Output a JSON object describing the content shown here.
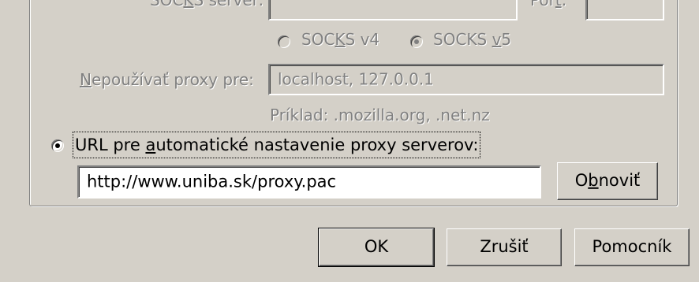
{
  "proxy": {
    "socks_server_label": "SO_C_KS server:",
    "port_label": "Port:",
    "socks_v4": {
      "prefix": "SOC",
      "u": "K",
      "suffix": "S v4"
    },
    "socks_v5": {
      "prefix": "SOCKS ",
      "u": "v",
      "suffix": "5"
    },
    "no_proxy": {
      "u": "N",
      "rest": "epoužívať proxy pre:",
      "value": "localhost, 127.0.0.1"
    },
    "example": "Príklad: .mozilla.org, .net.nz",
    "auto_url": {
      "prefix": "URL pre ",
      "u": "a",
      "suffix": "utomatické nastavenie proxy serverov:",
      "value": "http://www.uniba.sk/proxy.pac"
    },
    "reload": {
      "prefix": "O",
      "u": "b",
      "suffix": "noviť"
    }
  },
  "buttons": {
    "ok": "OK",
    "cancel": "Zrušiť",
    "help": "Pomocník"
  }
}
